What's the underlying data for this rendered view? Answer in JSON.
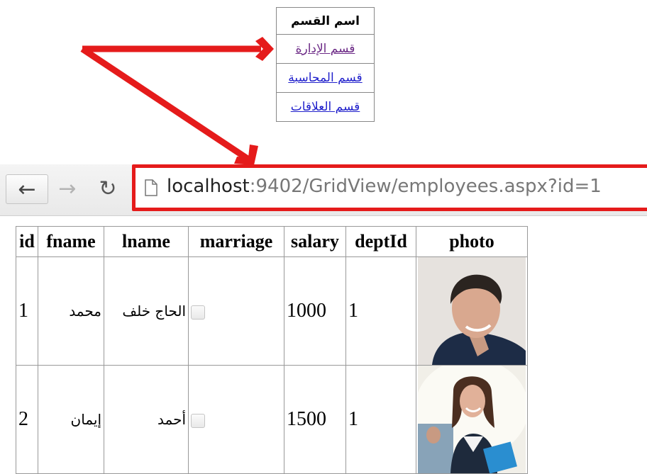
{
  "departments": {
    "header": "اسم القسم",
    "items": [
      {
        "label": "قسم الإدارة",
        "visited": true
      },
      {
        "label": "قسم المحاسبة",
        "visited": false
      },
      {
        "label": "قسم العلاقات",
        "visited": false
      }
    ]
  },
  "browser": {
    "url_host": "localhost",
    "url_rest": ":9402/GridView/employees.aspx?id=1",
    "icons": {
      "back": "arrow-left-icon",
      "forward": "arrow-right-icon",
      "reload": "reload-icon",
      "page": "page-icon"
    }
  },
  "annotation": {
    "color": "#e51b1b"
  },
  "grid": {
    "columns": [
      "id",
      "fname",
      "lname",
      "marriage",
      "salary",
      "deptId",
      "photo"
    ],
    "rows": [
      {
        "id": "1",
        "fname": "محمد",
        "lname": "الحاج خلف",
        "marriage": false,
        "salary": "1000",
        "deptId": "1",
        "photo": "man-portrait"
      },
      {
        "id": "2",
        "fname": "إيمان",
        "lname": "أحمد",
        "marriage": false,
        "salary": "1500",
        "deptId": "1",
        "photo": "woman-portrait"
      }
    ]
  }
}
